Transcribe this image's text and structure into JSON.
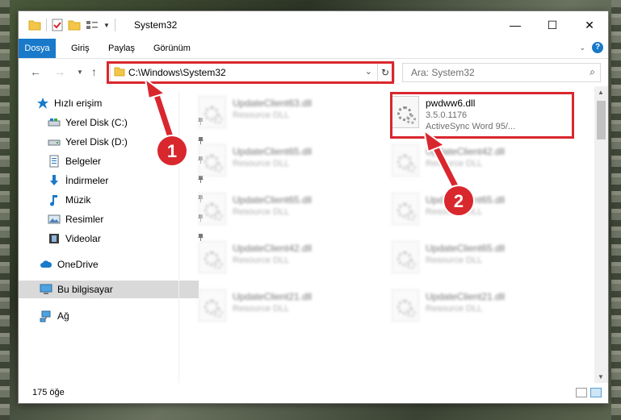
{
  "window": {
    "title": "System32",
    "controls": {
      "minimize": "—",
      "maximize": "☐",
      "close": "✕"
    }
  },
  "ribbon": {
    "tabs": [
      "Dosya",
      "Giriş",
      "Paylaş",
      "Görünüm"
    ],
    "help": "?"
  },
  "navigation": {
    "address": "C:\\Windows\\System32",
    "search_placeholder": "Ara: System32"
  },
  "sidebar": {
    "items": [
      {
        "label": "Hızlı erişim",
        "icon": "star-icon"
      },
      {
        "label": "Yerel Disk (C:)",
        "icon": "drive-icon",
        "pinned": true
      },
      {
        "label": "Yerel Disk (D:)",
        "icon": "drive-icon",
        "pinned": true
      },
      {
        "label": "Belgeler",
        "icon": "documents-icon",
        "pinned": true
      },
      {
        "label": "İndirmeler",
        "icon": "download-icon",
        "pinned": true
      },
      {
        "label": "Müzik",
        "icon": "music-icon",
        "pinned": true
      },
      {
        "label": "Resimler",
        "icon": "pictures-icon",
        "pinned": true
      },
      {
        "label": "Videolar",
        "icon": "videos-icon",
        "pinned": true
      },
      {
        "label": "OneDrive",
        "icon": "cloud-icon"
      },
      {
        "label": "Bu bilgisayar",
        "icon": "computer-icon",
        "selected": true
      },
      {
        "label": "Ağ",
        "icon": "network-icon"
      }
    ]
  },
  "files": {
    "highlighted": {
      "name": "pwdww6.dll",
      "version": "3.5.0.1176",
      "description": "ActiveSync Word 95/..."
    },
    "left_column": [
      {
        "name": "UpdateClient63.dll",
        "type": "Resource DLL"
      },
      {
        "name": "UpdateClient65.dll",
        "type": "Resource DLL"
      },
      {
        "name": "UpdateClient65.dll",
        "type": "Resource DLL"
      },
      {
        "name": "UpdateClient42.dll",
        "type": "Resource DLL"
      },
      {
        "name": "UpdateClient21.dll",
        "type": "Resource DLL"
      }
    ],
    "right_column": [
      {
        "name": "UpdateClient42.dll",
        "type": "Resource DLL"
      },
      {
        "name": "UpdateClient65.dll",
        "type": "Resource DLL"
      },
      {
        "name": "UpdateClient65.dll",
        "type": "Resource DLL"
      },
      {
        "name": "UpdateClient21.dll",
        "type": "Resource DLL"
      }
    ]
  },
  "status": {
    "item_count": "175 öğe"
  },
  "callouts": [
    "1",
    "2"
  ],
  "colors": {
    "accent": "#1979ca",
    "highlight": "#d9272e",
    "selected": "#d9d9d9"
  }
}
